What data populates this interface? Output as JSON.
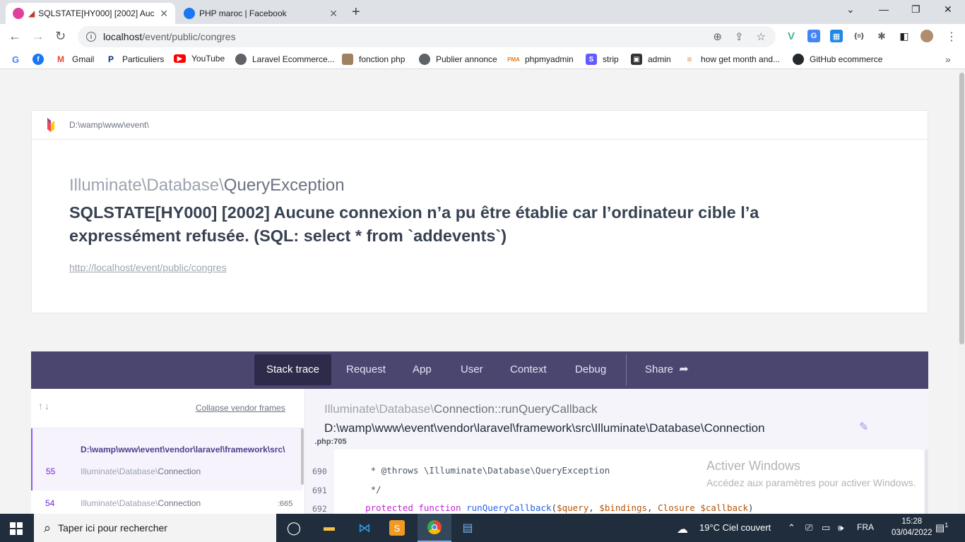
{
  "browser": {
    "tabs": [
      {
        "title": "SQLSTATE[HY000] [2002] Auc",
        "active": true
      },
      {
        "title": "PHP maroc | Facebook",
        "active": false
      }
    ],
    "url_host": "localhost",
    "url_path": "/event/public/congres",
    "bookmarks": [
      {
        "label": "Gmail",
        "icon": "gmail-icon"
      },
      {
        "label": "Particuliers",
        "icon": "paypal-icon"
      },
      {
        "label": "YouTube",
        "icon": "youtube-icon"
      },
      {
        "label": "Laravel Ecommerce...",
        "icon": "globe-icon"
      },
      {
        "label": "fonction php",
        "icon": "avatar-icon"
      },
      {
        "label": "Publier annonce",
        "icon": "globe-icon"
      },
      {
        "label": "phpmyadmin",
        "icon": "phpmyadmin-icon"
      },
      {
        "label": "strip",
        "icon": "stripe-icon"
      },
      {
        "label": "admin",
        "icon": "admin-icon"
      },
      {
        "label": "how get month and...",
        "icon": "stackoverflow-icon"
      },
      {
        "label": "GitHub ecommerce",
        "icon": "github-icon"
      }
    ]
  },
  "error": {
    "base_path": "D:\\wamp\\www\\event\\",
    "class_ns": "Illuminate\\Database\\",
    "class_name": "QueryException",
    "message": "SQLSTATE[HY000] [2002] Aucune connexion n’a pu être établie car l’ordinateur cible l’a expressément refusée. (SQL: select * from `addevents`)",
    "url": "http://localhost/event/public/congres"
  },
  "nav": {
    "tabs": [
      "Stack trace",
      "Request",
      "App",
      "User",
      "Context",
      "Debug"
    ],
    "share": "Share"
  },
  "stack": {
    "collapse_label": "Collapse vendor frames",
    "frames": [
      {
        "number": "55",
        "file": "D:\\wamp\\www\\event\\vendor\\laravel\\framework\\src\\",
        "class_ns": "Illuminate\\Database\\",
        "class_name": "Connection",
        "line": ""
      },
      {
        "number": "54",
        "class_ns": "Illuminate\\Database\\",
        "class_name": "Connection",
        "line": ":665"
      }
    ],
    "selected": {
      "method_ns": "Illuminate\\Database\\",
      "method_cls": "Connection",
      "method_name": "::runQueryCallback",
      "file_path": "D:\\wamp\\www\\event\\vendor\\laravel\\framework\\src\\Illuminate\\Database\\Connection",
      "file_ext": ".php:705"
    },
    "code": [
      {
        "ln": "690",
        "text": "     * @throws \\Illuminate\\Database\\QueryException"
      },
      {
        "ln": "691",
        "text": "     */"
      },
      {
        "ln": "692",
        "text": "    protected function runQueryCallback($query, $bindings, Closure $callback)"
      }
    ]
  },
  "watermark": {
    "title": "Activer Windows",
    "subtitle": "Accédez aux paramètres pour activer Windows."
  },
  "taskbar": {
    "search_placeholder": "Taper ici pour rechercher",
    "weather": "19°C  Ciel couvert",
    "lang": "FRA",
    "time": "15:28",
    "date": "03/04/2022",
    "notifications": "1"
  }
}
